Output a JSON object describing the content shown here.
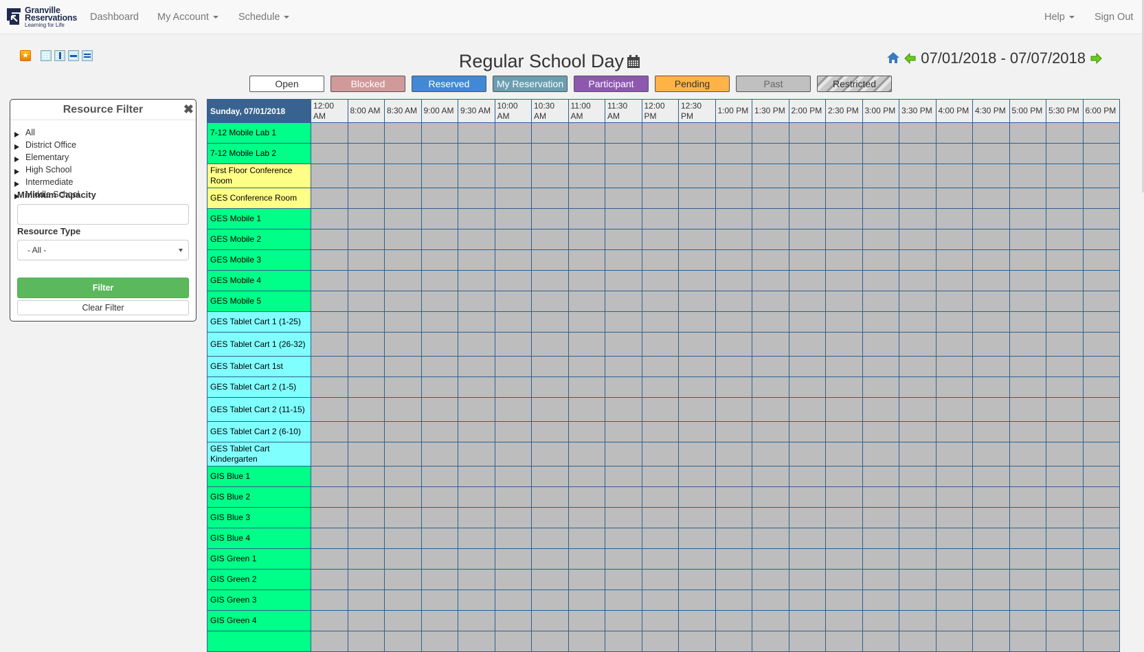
{
  "nav": {
    "logo": {
      "line1": "Granville",
      "line2": "Reservations",
      "tagline": "Learning for Life"
    },
    "links": [
      {
        "label": "Dashboard",
        "dropdown": false
      },
      {
        "label": "My Account",
        "dropdown": true
      },
      {
        "label": "Schedule",
        "dropdown": true
      }
    ],
    "right_links": [
      {
        "label": "Help",
        "dropdown": true
      },
      {
        "label": "Sign Out",
        "dropdown": false
      }
    ]
  },
  "toolbar": {
    "icons": [
      "favorite-star-icon",
      "layout-standard-icon",
      "layout-tall-icon",
      "layout-wide-icon",
      "layout-condensed-icon"
    ]
  },
  "schedule": {
    "title": "Regular School Day",
    "date_range": "07/01/2018 - 07/07/2018",
    "legend": [
      {
        "label": "Open",
        "bg": "#ffffff",
        "color": "#333333"
      },
      {
        "label": "Blocked",
        "bg": "#d09a9a",
        "color": "#ffffff"
      },
      {
        "label": "Reserved",
        "bg": "#4189d6",
        "color": "#ffffff"
      },
      {
        "label": "My Reservation",
        "bg": "#6a9eb0",
        "color": "#ffffff"
      },
      {
        "label": "Participant",
        "bg": "#8c58b0",
        "color": "#ffffff"
      },
      {
        "label": "Pending",
        "bg": "#ffb347",
        "color": "#333333"
      },
      {
        "label": "Past",
        "bg": "#c0c0c0",
        "color": "#666666"
      },
      {
        "label": "Restricted",
        "bg": "striped",
        "color": "#333333"
      }
    ]
  },
  "filter": {
    "title": "Resource Filter",
    "groups": [
      "All",
      "District Office",
      "Elementary",
      "High School",
      "Intermediate",
      "Middle School"
    ],
    "min_capacity_label": "Minimum Capacity",
    "min_capacity_value": "",
    "resource_type_label": "Resource Type",
    "resource_type_value": "- All -",
    "filter_button": "Filter",
    "clear_button": "Clear Filter"
  },
  "grid": {
    "day_label": "Sunday, 07/01/2018",
    "times": [
      "12:00 AM",
      "8:00 AM",
      "8:30 AM",
      "9:00 AM",
      "9:30 AM",
      "10:00 AM",
      "10:30 AM",
      "11:00 AM",
      "11:30 AM",
      "12:00 PM",
      "12:30 PM",
      "1:00 PM",
      "1:30 PM",
      "2:00 PM",
      "2:30 PM",
      "3:00 PM",
      "3:30 PM",
      "4:00 PM",
      "4:30 PM",
      "5:00 PM",
      "5:30 PM",
      "6:00 PM"
    ],
    "resources": [
      {
        "name": "7-12 Mobile Lab 1",
        "color": "#00ff88"
      },
      {
        "name": "7-12 Mobile Lab 2",
        "color": "#00ff88"
      },
      {
        "name": "First Floor Conference Room",
        "color": "#ffff88"
      },
      {
        "name": "GES Conference Room",
        "color": "#ffff88"
      },
      {
        "name": "GES Mobile 1",
        "color": "#00ff88"
      },
      {
        "name": "GES Mobile 2",
        "color": "#00ff88"
      },
      {
        "name": "GES Mobile 3",
        "color": "#00ff88"
      },
      {
        "name": "GES Mobile 4",
        "color": "#00ff88"
      },
      {
        "name": "GES Mobile 5",
        "color": "#00ff88"
      },
      {
        "name": "GES Tablet Cart 1 (1-25)",
        "color": "#80ffff"
      },
      {
        "name": "GES Tablet Cart 1 (26-32)",
        "color": "#80ffff"
      },
      {
        "name": "GES Tablet Cart 1st",
        "color": "#80ffff"
      },
      {
        "name": "GES Tablet Cart 2 (1-5)",
        "color": "#80ffff"
      },
      {
        "name": "GES Tablet Cart 2 (11-15)",
        "color": "#80ffff"
      },
      {
        "name": "GES Tablet Cart 2 (6-10)",
        "color": "#80ffff"
      },
      {
        "name": "GES Tablet Cart Kindergarten",
        "color": "#80ffff"
      },
      {
        "name": "GIS Blue 1",
        "color": "#00ff88"
      },
      {
        "name": "GIS Blue 2",
        "color": "#00ff88"
      },
      {
        "name": "GIS Blue 3",
        "color": "#00ff88"
      },
      {
        "name": "GIS Blue 4",
        "color": "#00ff88"
      },
      {
        "name": "GIS Green 1",
        "color": "#00ff88"
      },
      {
        "name": "GIS Green 2",
        "color": "#00ff88"
      },
      {
        "name": "GIS Green 3",
        "color": "#00ff88"
      },
      {
        "name": "GIS Green 4",
        "color": "#00ff88"
      },
      {
        "name": "",
        "color": "#00ff88"
      }
    ],
    "slot_state": "Past"
  }
}
